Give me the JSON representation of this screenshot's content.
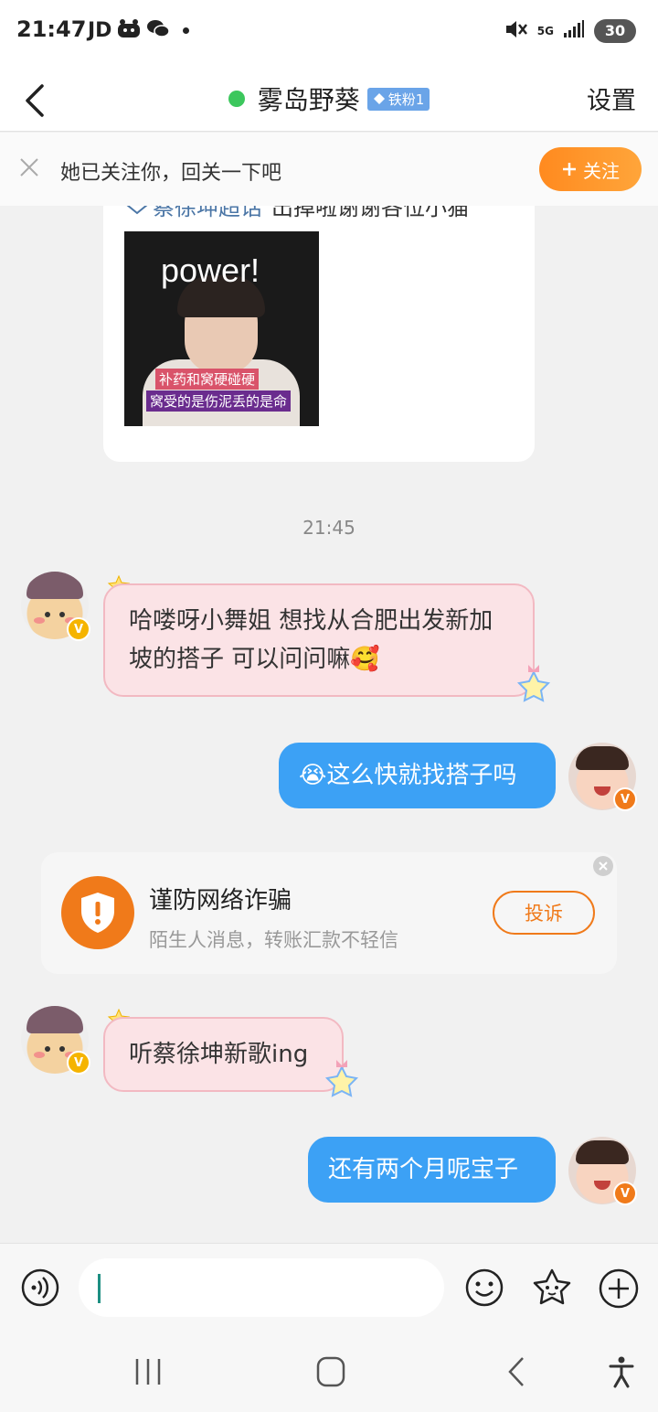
{
  "status_bar": {
    "time": "21:47",
    "carrier": "JD",
    "network": "5G",
    "battery": "30"
  },
  "header": {
    "title": "雾岛野葵",
    "badge": "铁粉1",
    "settings": "设置"
  },
  "follow_banner": {
    "text": "她已关注你，回关一下吧",
    "button": "关注"
  },
  "shared_post": {
    "topic": "蔡徐坤超话",
    "text": "出掉啦谢谢各位小猫",
    "image_text": "power!",
    "caption_line1": "补药和窝硬碰硬",
    "caption_line2": "窝受的是伤泥丢的是命"
  },
  "timestamp": "21:45",
  "messages": [
    {
      "direction": "in",
      "text": "哈喽呀小舞姐 想找从合肥出发新加坡的搭子 可以问问嘛🥰"
    },
    {
      "direction": "out",
      "text": "😭这么快就找搭子吗"
    },
    {
      "direction": "in",
      "text": "听蔡徐坤新歌ing"
    },
    {
      "direction": "out",
      "text": "还有两个月呢宝子"
    }
  ],
  "security_notice": {
    "title": "谨防网络诈骗",
    "subtitle": "陌生人消息，转账汇款不轻信",
    "button": "投诉"
  },
  "colors": {
    "accent_orange": "#f07a1a",
    "bubble_out": "#3ca1f5",
    "bubble_in": "#fbe3e6",
    "online": "#3cc75d"
  }
}
